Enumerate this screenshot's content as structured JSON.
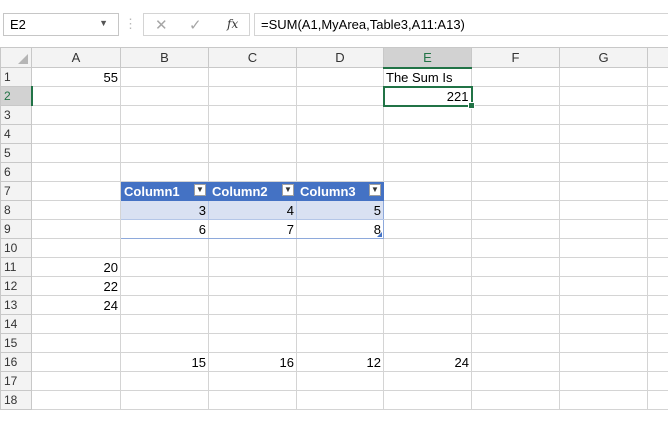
{
  "name_box": {
    "value": "E2",
    "dropdown_icon": "triangle-down"
  },
  "formula_bar": {
    "cancel_icon": "x-icon",
    "enter_icon": "check-icon",
    "fx_label": "fx",
    "formula": "=SUM(A1,MyArea,Table3,A11:A13)"
  },
  "columns": [
    "A",
    "B",
    "C",
    "D",
    "E",
    "F",
    "G"
  ],
  "rows": [
    "1",
    "2",
    "3",
    "4",
    "5",
    "6",
    "7",
    "8",
    "9",
    "10",
    "11",
    "12",
    "13",
    "14",
    "15",
    "16",
    "17",
    "18"
  ],
  "cells": {
    "A1": "55",
    "E1": "The Sum Is",
    "E2": "221",
    "B7": "Column1",
    "C7": "Column2",
    "D7": "Column3",
    "B8": "3",
    "C8": "4",
    "D8": "5",
    "B9": "6",
    "C9": "7",
    "D9": "8",
    "A11": "20",
    "A12": "22",
    "A13": "24",
    "B16": "15",
    "C16": "16",
    "D16": "12",
    "E16": "24"
  },
  "filter_icon": "dropdown-arrow-icon",
  "filter_glyph": "▼",
  "colors": {
    "selection": "#217346",
    "table_header": "#4472c4",
    "table_band": "#d9e1f2"
  }
}
